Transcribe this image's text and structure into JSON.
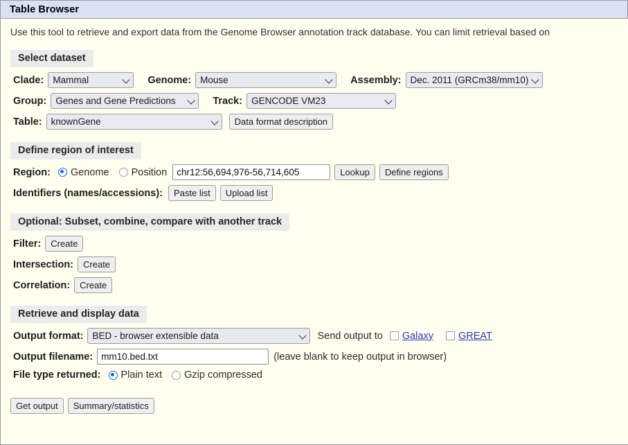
{
  "window": {
    "title": "Table Browser"
  },
  "intro": {
    "text": "Use this tool to retrieve and export data from the Genome Browser annotation track database. You can limit retrieval based on"
  },
  "select_dataset": {
    "heading": "Select dataset",
    "clade_label": "Clade:",
    "clade_value": "Mammal",
    "genome_label": "Genome:",
    "genome_value": "Mouse",
    "assembly_label": "Assembly:",
    "assembly_value": "Dec. 2011 (GRCm38/mm10)",
    "group_label": "Group:",
    "group_value": "Genes and Gene Predictions",
    "track_label": "Track:",
    "track_value": "GENCODE VM23",
    "table_label": "Table:",
    "table_value": "knownGene",
    "data_format_button": "Data format description"
  },
  "define_region": {
    "heading": "Define region of interest",
    "region_label": "Region:",
    "genome_option": "Genome",
    "position_option": "Position",
    "selected_region": "Genome",
    "position_value": "chr12:56,694,976-56,714,605",
    "lookup_button": "Lookup",
    "define_regions_button": "Define regions",
    "identifiers_label": "Identifiers (names/accessions):",
    "paste_list_button": "Paste list",
    "upload_list_button": "Upload list"
  },
  "optional": {
    "heading": "Optional: Subset, combine, compare with another track",
    "filter_label": "Filter:",
    "filter_button": "Create",
    "intersection_label": "Intersection:",
    "intersection_button": "Create",
    "correlation_label": "Correlation:",
    "correlation_button": "Create"
  },
  "retrieve": {
    "heading": "Retrieve and display data",
    "output_format_label": "Output format:",
    "output_format_value": "BED - browser extensible data",
    "send_output_label": "Send output to",
    "galaxy_link": "Galaxy",
    "galaxy_checked": false,
    "great_link": "GREAT",
    "great_checked": false,
    "output_filename_label": "Output filename:",
    "output_filename_value": "mm10.bed.txt",
    "filename_hint": "(leave blank to keep output in browser)",
    "file_type_label": "File type returned:",
    "plain_text_option": "Plain text",
    "gzip_option": "Gzip compressed",
    "selected_file_type": "Plain text",
    "get_output_button": "Get output",
    "summary_button": "Summary/statistics"
  },
  "colors": {
    "titlebar_bg": "#dae1f5",
    "page_bg": "#fffff0",
    "section_head_bg": "#ebebeb",
    "accent_radio": "#1a6bd8",
    "link": "#3333bb"
  }
}
